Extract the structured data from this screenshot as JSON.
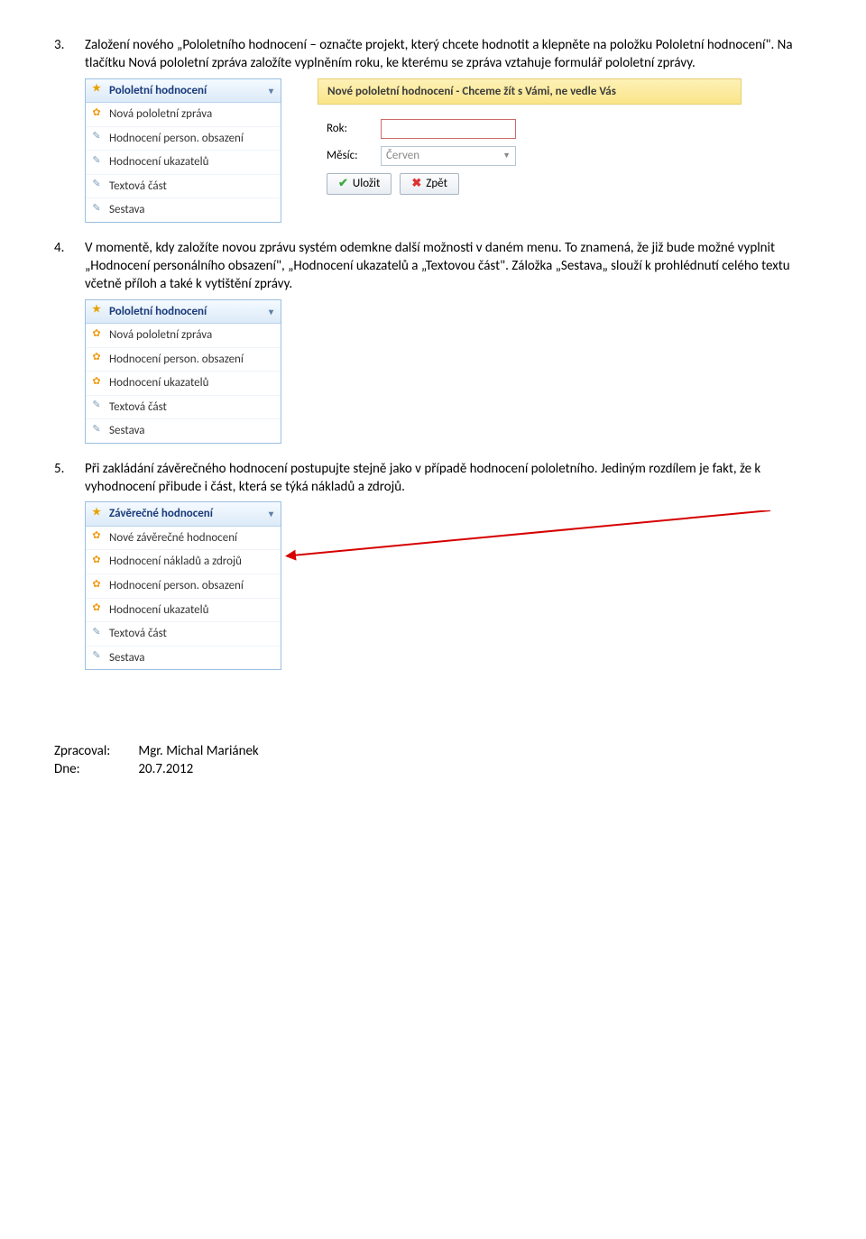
{
  "step3": {
    "num": "3.",
    "text": "Založení nového „Pololetního hodnocení – označte projekt, který chcete hodnotit a klepněte na položku Pololetní hodnocení\". Na tlačítku Nová pololetní zpráva založíte vyplněním roku, ke kterému se zpráva vztahuje formulář pololetní zprávy."
  },
  "menu1": {
    "header": "Pololetní hodnocení",
    "items": [
      "Nová pololetní zpráva",
      "Hodnocení person. obsazení",
      "Hodnocení ukazatelů",
      "Textová část",
      "Sestava"
    ]
  },
  "form": {
    "title": "Nové pololetní hodnocení - Chceme žít s Vámi, ne vedle Vás",
    "rok_label": "Rok:",
    "mesic_label": "Měsíc:",
    "mesic_value": "Červen",
    "save": "Uložit",
    "back": "Zpět"
  },
  "step4": {
    "num": "4.",
    "text": "V momentě, kdy založíte novou zprávu systém odemkne další možnosti v daném menu. To znamená, že již bude možné vyplnit „Hodnocení personálního obsazení\", „Hodnocení ukazatelů a „Textovou část\". Záložka „Sestava„ slouží k prohlédnutí celého textu včetně příloh a také k vytištění zprávy."
  },
  "menu2": {
    "header": "Pololetní hodnocení",
    "items": [
      "Nová pololetní zpráva",
      "Hodnocení person. obsazení",
      "Hodnocení ukazatelů",
      "Textová část",
      "Sestava"
    ]
  },
  "step5": {
    "num": "5.",
    "text": "Při zakládání závěrečného hodnocení postupujte stejně jako v případě hodnocení pololetního. Jediným rozdílem je fakt, že k vyhodnocení přibude i část, která se týká nákladů a zdrojů."
  },
  "menu3": {
    "header": "Závěrečné hodnocení",
    "items": [
      "Nové závěrečné hodnocení",
      "Hodnocení nákladů a zdrojů",
      "Hodnocení person. obsazení",
      "Hodnocení ukazatelů",
      "Textová část",
      "Sestava"
    ]
  },
  "footer": {
    "zprac_label": "Zpracoval:",
    "zprac_value": "Mgr. Michal Mariánek",
    "dne_label": "Dne:",
    "dne_value": "20.7.2012"
  }
}
